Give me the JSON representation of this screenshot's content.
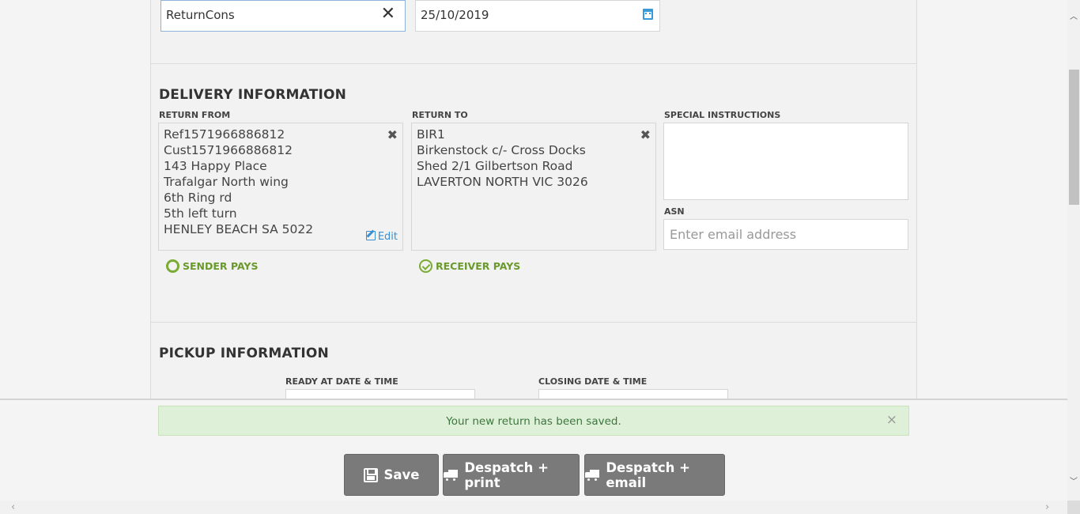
{
  "reference": {
    "value": "ReturnCons",
    "clear_icon": "close-icon"
  },
  "date": {
    "value": "25/10/2019",
    "icon": "calendar-icon"
  },
  "delivery": {
    "title": "DELIVERY INFORMATION",
    "return_from": {
      "label": "RETURN FROM",
      "lines": [
        "Ref1571966886812",
        "Cust1571966886812",
        "143 Happy Place",
        "Trafalgar North wing",
        "6th Ring rd",
        "5th left turn",
        "HENLEY BEACH SA 5022"
      ],
      "edit_label": "Edit"
    },
    "return_to": {
      "label": "RETURN TO",
      "lines": [
        "BIR1",
        "Birkenstock c/- Cross Docks",
        "Shed 2/1 Gilbertson Road",
        "LAVERTON NORTH VIC 3026"
      ]
    },
    "special_instructions": {
      "label": "SPECIAL INSTRUCTIONS",
      "value": ""
    },
    "asn": {
      "label": "ASN",
      "placeholder": "Enter email address"
    },
    "payment": {
      "sender_label": "SENDER PAYS",
      "receiver_label": "RECEIVER PAYS",
      "selected": "receiver"
    }
  },
  "pickup": {
    "title": "PICKUP INFORMATION",
    "ready_label": "READY AT DATE & TIME",
    "closing_label": "CLOSING DATE & TIME"
  },
  "footer": {
    "alert_message": "Your new return has been saved.",
    "alert_close": "×",
    "save_label": "Save",
    "despatch_print_label": "Despatch + print",
    "despatch_email_label": "Despatch + email"
  },
  "colors": {
    "accent": "#3a8fd0",
    "success_text": "#3c763d",
    "success_bg": "#dff0d8",
    "radio": "#7aac34",
    "button": "#7a7a7a"
  }
}
